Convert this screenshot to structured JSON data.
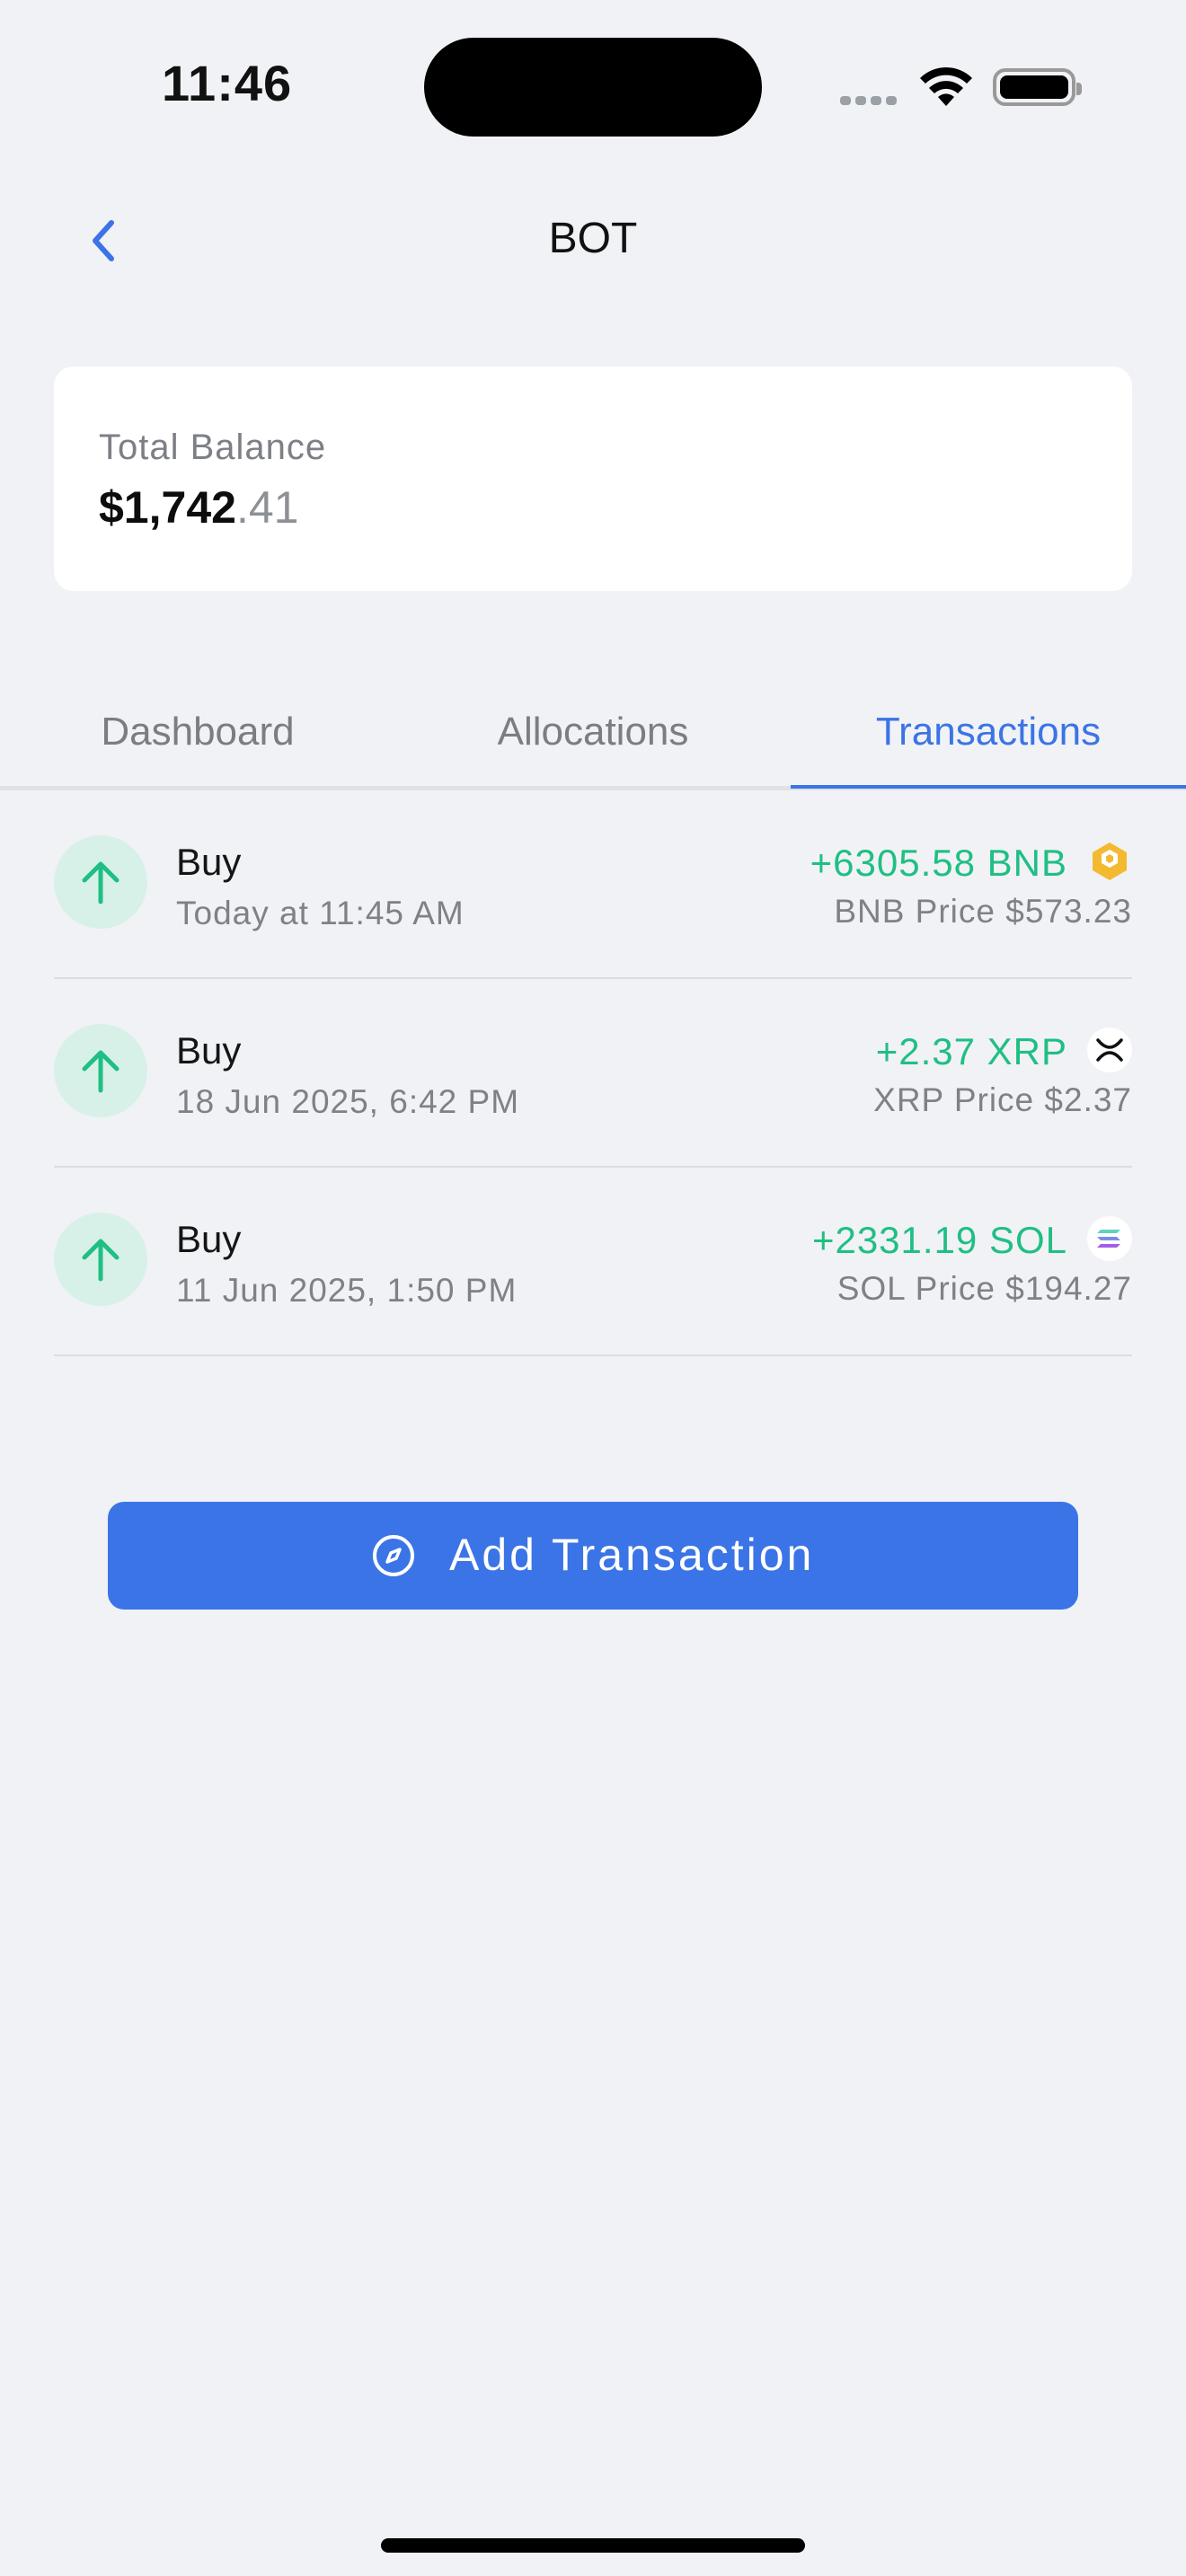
{
  "status_bar": {
    "time": "11:46"
  },
  "nav": {
    "title": "BOT"
  },
  "balance": {
    "label": "Total Balance",
    "amount_main": "$1,742",
    "amount_decimal": ".41"
  },
  "tabs": [
    {
      "label": "Dashboard",
      "active": false
    },
    {
      "label": "Allocations",
      "active": false
    },
    {
      "label": "Transactions",
      "active": true
    }
  ],
  "transactions": [
    {
      "type": "Buy",
      "date": "Today at 11:45 AM",
      "amount": "+6305.58 BNB",
      "price": "BNB Price $573.23",
      "coin_icon": "bnb-icon"
    },
    {
      "type": "Buy",
      "date": "18 Jun 2025, 6:42 PM",
      "amount": "+2.37 XRP",
      "price": "XRP Price $2.37",
      "coin_icon": "xrp-icon"
    },
    {
      "type": "Buy",
      "date": "11 Jun 2025, 1:50 PM",
      "amount": "+2331.19 SOL",
      "price": "SOL Price $194.27",
      "coin_icon": "sol-icon"
    }
  ],
  "add_button": {
    "label": "Add Transaction",
    "icon": "compass-icon"
  },
  "colors": {
    "accent": "#3b74e6",
    "positive": "#1fbf84",
    "background": "#f1f2f5"
  }
}
